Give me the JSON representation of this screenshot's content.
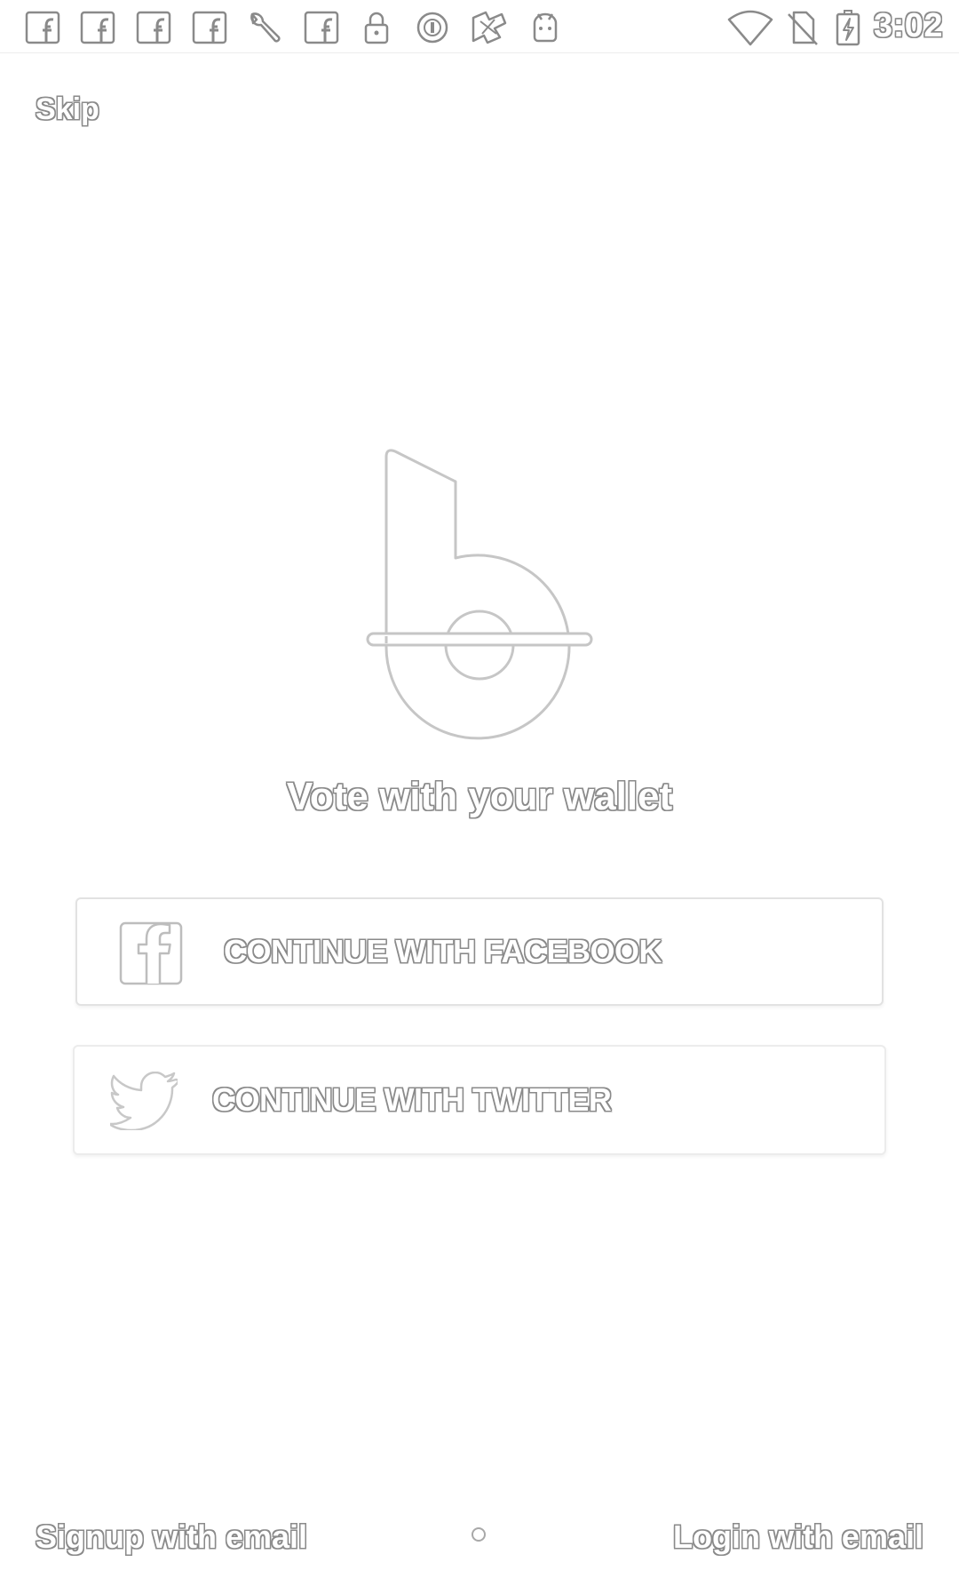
{
  "status_bar": {
    "time": "3:02",
    "notification_icons": [
      "facebook-icon",
      "facebook-icon",
      "facebook-icon",
      "facebook-icon",
      "wrench-icon",
      "facebook-icon",
      "lock-icon",
      "circle-icon",
      "app-icon",
      "android-icon"
    ],
    "system_icons": [
      "wifi-icon",
      "no-sim-icon",
      "battery-charging-icon"
    ]
  },
  "onboarding": {
    "skip_label": "Skip",
    "tagline": "Vote with your wallet",
    "facebook_button_label": "CONTINUE WITH FACEBOOK",
    "twitter_button_label": "CONTINUE WITH TWITTER",
    "signup_label": "Signup with email",
    "login_label": "Login with email"
  },
  "colors": {
    "background": "#ffffff",
    "outline": "#8a8a8a"
  }
}
